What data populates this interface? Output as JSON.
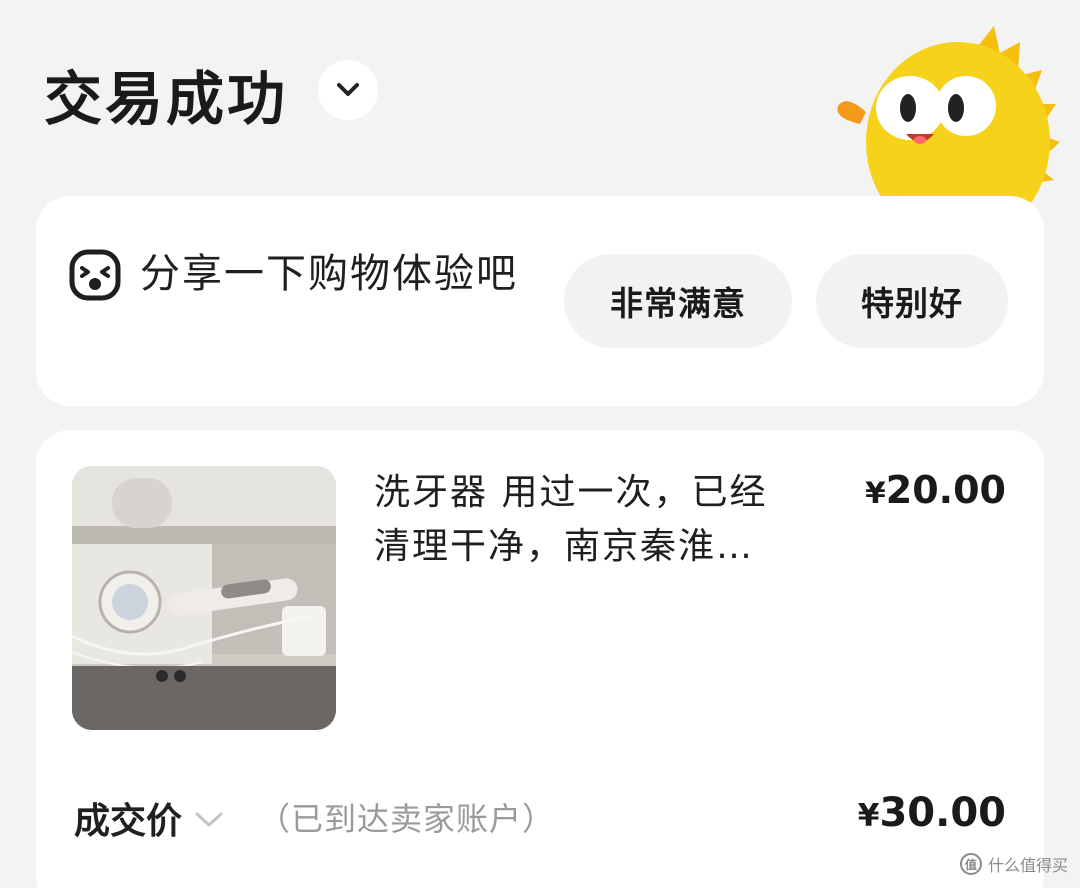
{
  "header": {
    "status_title": "交易成功"
  },
  "share": {
    "prompt": "分享一下购物体验吧",
    "options": [
      "非常满意",
      "特别好"
    ]
  },
  "order": {
    "item_title_line1": "洗牙器 用过一次，已经",
    "item_title_line2": "清理干净，南京秦淮…",
    "item_price_symbol": "¥",
    "item_price": "20.00",
    "deal_label": "成交价",
    "deal_note": "（已到达卖家账户）",
    "final_price_symbol": "¥",
    "final_price": "30.00"
  },
  "watermark": {
    "icon_glyph": "值",
    "text": "什么值得买"
  },
  "icons": {
    "status_toggle": "chevron-down-icon",
    "share": "happy-face-icon",
    "mascot": "mascot-fish",
    "price_toggle": "chevron-down-icon"
  },
  "colors": {
    "background": "#f3f3f3",
    "card": "#ffffff",
    "chip": "#f2f2f2",
    "muted_text": "#9a9a9a",
    "mascot_yellow": "#f7d21a"
  }
}
